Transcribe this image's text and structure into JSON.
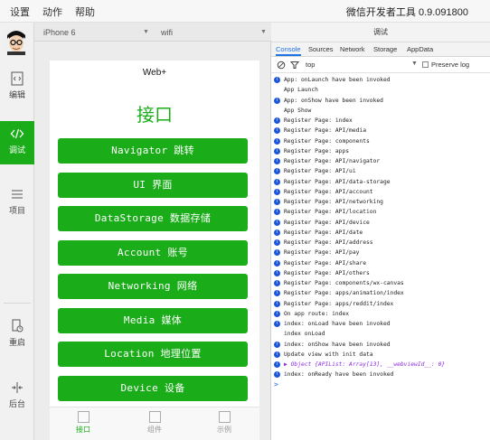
{
  "menu": {
    "settings": "设置",
    "actions": "动作",
    "help": "帮助"
  },
  "app_title": "微信开发者工具 0.9.091800",
  "sidebar": {
    "items": [
      {
        "label": "编辑",
        "icon": "code-file-icon"
      },
      {
        "label": "调试",
        "icon": "debug-code-icon"
      },
      {
        "label": "项目",
        "icon": "list-icon"
      },
      {
        "label": "重启",
        "icon": "restart-icon"
      },
      {
        "label": "后台",
        "icon": "background-icon"
      }
    ]
  },
  "simulator": {
    "device": "iPhone 6",
    "network": "wifi",
    "nav_title": "Web+",
    "page_title": "接口",
    "buttons": [
      "Navigator 跳转",
      "UI 界面",
      "DataStorage 数据存储",
      "Account 账号",
      "Networking 网络",
      "Media 媒体",
      "Location 地理位置",
      "Device 设备"
    ],
    "tabs": [
      "接口",
      "组件",
      "示例"
    ]
  },
  "devtools": {
    "title": "调试",
    "tabs": [
      "Console",
      "Sources",
      "Network",
      "Storage",
      "AppData"
    ],
    "filter_context": "top",
    "preserve_log": "Preserve log",
    "logs": [
      {
        "info": true,
        "text": "App: onLaunch have been invoked"
      },
      {
        "info": false,
        "text": "App Launch"
      },
      {
        "info": true,
        "text": "App: onShow have been invoked"
      },
      {
        "info": false,
        "text": "App Show"
      },
      {
        "info": true,
        "text": "Register Page: index"
      },
      {
        "info": true,
        "text": "Register Page: API/media"
      },
      {
        "info": true,
        "text": "Register Page: components"
      },
      {
        "info": true,
        "text": "Register Page: apps"
      },
      {
        "info": true,
        "text": "Register Page: API/navigator"
      },
      {
        "info": true,
        "text": "Register Page: API/ui"
      },
      {
        "info": true,
        "text": "Register Page: API/data-storage"
      },
      {
        "info": true,
        "text": "Register Page: API/account"
      },
      {
        "info": true,
        "text": "Register Page: API/networking"
      },
      {
        "info": true,
        "text": "Register Page: API/location"
      },
      {
        "info": true,
        "text": "Register Page: API/device"
      },
      {
        "info": true,
        "text": "Register Page: API/date"
      },
      {
        "info": true,
        "text": "Register Page: API/address"
      },
      {
        "info": true,
        "text": "Register Page: API/pay"
      },
      {
        "info": true,
        "text": "Register Page: API/share"
      },
      {
        "info": true,
        "text": "Register Page: API/others"
      },
      {
        "info": true,
        "text": "Register Page: components/wx-canvas"
      },
      {
        "info": true,
        "text": "Register Page: apps/animation/index"
      },
      {
        "info": true,
        "text": "Register Page: apps/reddit/index"
      },
      {
        "info": true,
        "text": "On app route: index"
      },
      {
        "info": true,
        "text": "index: onLoad have been invoked"
      },
      {
        "info": false,
        "text": "index onLoad"
      },
      {
        "info": true,
        "text": "index: onShow have been invoked"
      },
      {
        "info": true,
        "text": "Update view with init data"
      },
      {
        "info": true,
        "text": "▶ Object {APIList: Array[13], __webviewId__: 0}",
        "object": true
      },
      {
        "info": true,
        "text": "index: onReady have been invoked"
      }
    ],
    "prompt": ">"
  },
  "colors": {
    "accent": "#1aad19",
    "info": "#1a56db",
    "link": "#1a73e8"
  }
}
